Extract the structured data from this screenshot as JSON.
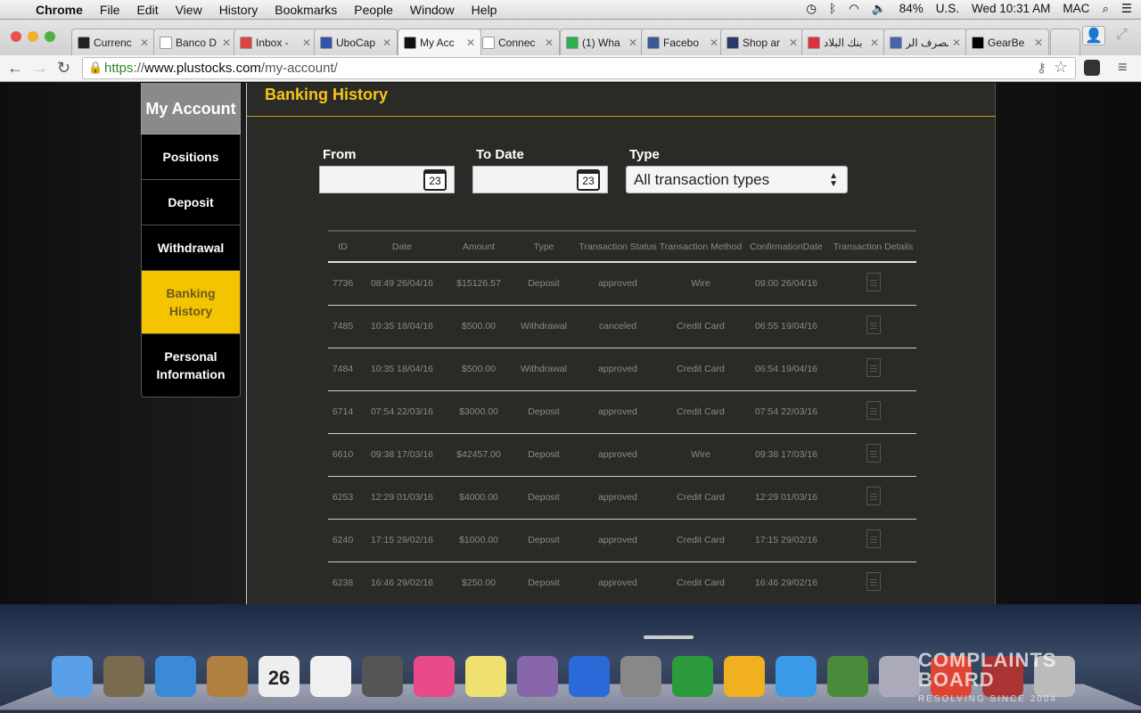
{
  "menubar": {
    "app": "Chrome",
    "items": [
      "File",
      "Edit",
      "View",
      "History",
      "Bookmarks",
      "People",
      "Window",
      "Help"
    ],
    "battery": "84%",
    "input": "U.S.",
    "clock": "Wed 10:31 AM",
    "user": "MAC"
  },
  "tabs": [
    {
      "title": "Currenc",
      "color": "#222"
    },
    {
      "title": "Banco D",
      "color": "#fff"
    },
    {
      "title": "Inbox -",
      "color": "#d44"
    },
    {
      "title": "UboCap",
      "color": "#3355aa"
    },
    {
      "title": "My Acc",
      "color": "#111",
      "active": true
    },
    {
      "title": "Connec",
      "color": "#fff"
    },
    {
      "title": "(1) Wha",
      "color": "#2bb24c"
    },
    {
      "title": "Facebo",
      "color": "#3b5998"
    },
    {
      "title": "Shop ar",
      "color": "#2a3a6a"
    },
    {
      "title": "بنك البلاد",
      "color": "#e03040"
    },
    {
      "title": "مصرف الر",
      "color": "#4466aa"
    },
    {
      "title": "GearBe",
      "color": "#000"
    }
  ],
  "url": {
    "scheme": "https",
    "sep": "://",
    "domain": "www.plustocks.com",
    "path": "/my-account/"
  },
  "sidebar": {
    "header": "My Account",
    "items": [
      "Positions",
      "Deposit",
      "Withdrawal",
      "Banking History",
      "Personal Information"
    ],
    "active": 3
  },
  "main": {
    "title": "Banking History",
    "filters": {
      "from_label": "From",
      "to_label": "To Date",
      "type_label": "Type",
      "type_value": "All transaction types",
      "calendar_day": "23"
    }
  },
  "table": {
    "headers": [
      "ID",
      "Date",
      "Amount",
      "Type",
      "Transaction Status",
      "Transaction Method",
      "ConfirmationDate",
      "Transaction Details"
    ],
    "rows": [
      [
        "7736",
        "08:49 26/04/16",
        "$15126.57",
        "Deposit",
        "approved",
        "Wire",
        "09:00 26/04/16"
      ],
      [
        "7485",
        "10:35 18/04/16",
        "$500.00",
        "Withdrawal",
        "canceled",
        "Credit Card",
        "06:55 19/04/16"
      ],
      [
        "7484",
        "10:35 18/04/16",
        "$500.00",
        "Withdrawal",
        "approved",
        "Credit Card",
        "06:54 19/04/16"
      ],
      [
        "6714",
        "07:54 22/03/16",
        "$3000.00",
        "Deposit",
        "approved",
        "Credit Card",
        "07:54 22/03/16"
      ],
      [
        "6610",
        "09:38 17/03/16",
        "$42457.00",
        "Deposit",
        "approved",
        "Wire",
        "09:38 17/03/16"
      ],
      [
        "6253",
        "12:29 01/03/16",
        "$4000.00",
        "Deposit",
        "approved",
        "Credit Card",
        "12:29 01/03/16"
      ],
      [
        "6240",
        "17:15 29/02/16",
        "$1000.00",
        "Deposit",
        "approved",
        "Credit Card",
        "17:15 29/02/16"
      ],
      [
        "6238",
        "16:46 29/02/16",
        "$250.00",
        "Deposit",
        "approved",
        "Credit Card",
        "16:46 29/02/16"
      ]
    ]
  },
  "dock": {
    "apps": [
      {
        "name": "finder",
        "color": "#5aa0e8"
      },
      {
        "name": "photos",
        "color": "#7a6a50"
      },
      {
        "name": "safari",
        "color": "#3a8ad8"
      },
      {
        "name": "contacts",
        "color": "#b08040"
      },
      {
        "name": "calendar",
        "color": "#eee",
        "label": "26"
      },
      {
        "name": "reminders",
        "color": "#f0f0f0"
      },
      {
        "name": "facetime",
        "color": "#555"
      },
      {
        "name": "itunes",
        "color": "#e84a8a"
      },
      {
        "name": "stickies",
        "color": "#f0e070"
      },
      {
        "name": "gamecenter",
        "color": "#8866aa"
      },
      {
        "name": "word",
        "color": "#2a6ad8"
      },
      {
        "name": "system-preferences",
        "color": "#888"
      },
      {
        "name": "excel",
        "color": "#2a9a3a"
      },
      {
        "name": "outlook",
        "color": "#f0b020"
      },
      {
        "name": "messenger",
        "color": "#3a9ae8"
      },
      {
        "name": "downloader",
        "color": "#4a8a3a"
      },
      {
        "name": "preview",
        "color": "#aab"
      },
      {
        "name": "chrome",
        "color": "#dd4433"
      },
      {
        "name": "photo-booth",
        "color": "#aa3333"
      },
      {
        "name": "trash",
        "color": "#bbb"
      }
    ]
  },
  "watermark": {
    "line1": "COMPLAINTS",
    "line2": "BOARD",
    "tagline": "RESOLVING SINCE 2004"
  }
}
